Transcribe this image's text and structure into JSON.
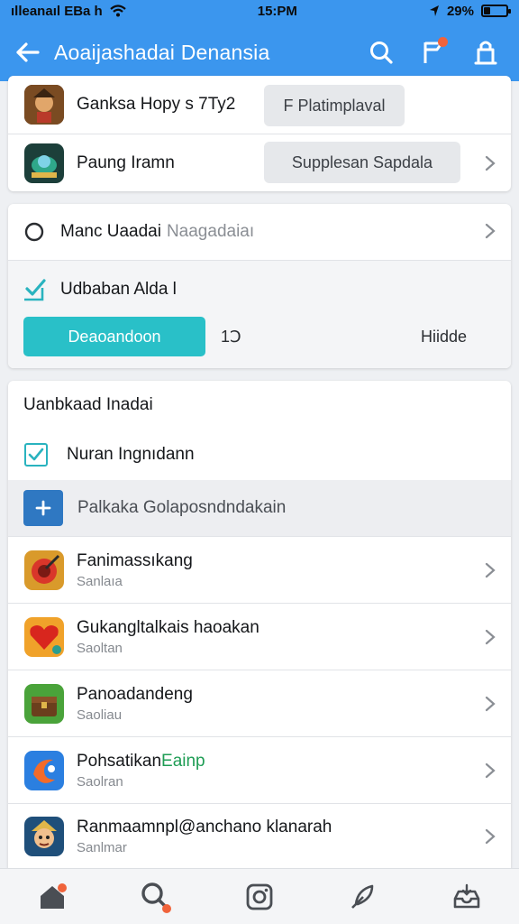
{
  "status_bar": {
    "carrier": "ılleanaıl EBa h",
    "time": "15:PM",
    "battery": "29%",
    "battery_level": 0.29
  },
  "app_bar": {
    "title": "Aoaijashadai Denansia",
    "icons": [
      "back-arrow-icon",
      "search-icon",
      "notification-flag-icon",
      "bag-icon"
    ],
    "accent_color": "#3b96ee",
    "badge_color": "#f0633b"
  },
  "top_card": {
    "items": [
      {
        "title": "Ganksa Hopy s 7Ty2",
        "action": "F Platimplaval"
      },
      {
        "title": "Paung Iramn",
        "action": "Supplesan Sapdala"
      }
    ]
  },
  "options": {
    "radio": {
      "label": "Manc Uaadai",
      "hint": "Naagadaiaı"
    },
    "checkbox": {
      "label": "Udbaban Alda l"
    },
    "button": "Deaoandoon",
    "count": "1Ↄ",
    "hide": "Hiidde"
  },
  "list_section": {
    "header": "Uanbkaad Inadai",
    "checkbox_item": "Nuran Ingnıdann",
    "add_item": "Palkaka Golaposndndakain",
    "apps": [
      {
        "title": "Fanimassıkang",
        "subtitle": "Sanlaıa"
      },
      {
        "title": "Gukangltalkais haoakan",
        "subtitle": "Saoltan"
      },
      {
        "title": "Panoadandeng",
        "subtitle": "Saoliau"
      },
      {
        "title": "Pohsatikan",
        "title_extra": "Eainp",
        "subtitle": "Saolran"
      },
      {
        "title": "Ranmaamnpl@anchano klanarah",
        "subtitle": "Sanlmar"
      }
    ]
  },
  "bottom_nav": [
    "home-icon",
    "search-icon",
    "camera-icon",
    "feather-icon",
    "inbox-icon"
  ],
  "colors": {
    "teal": "#29c0c8",
    "green_text": "#1f9d55"
  }
}
